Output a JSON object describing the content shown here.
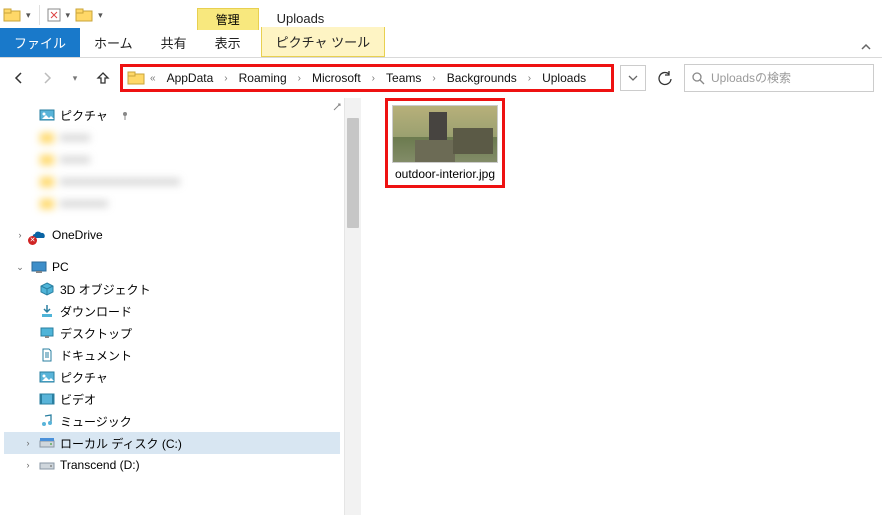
{
  "window": {
    "title": "Uploads"
  },
  "ribbon": {
    "context_tab": "管理",
    "file": "ファイル",
    "home": "ホーム",
    "share": "共有",
    "view": "表示",
    "picture_tools": "ピクチャ ツール"
  },
  "address": {
    "overflow": "«",
    "crumbs": [
      "AppData",
      "Roaming",
      "Microsoft",
      "Teams",
      "Backgrounds",
      "Uploads"
    ]
  },
  "search": {
    "placeholder": "Uploadsの検索"
  },
  "tree": {
    "quick_access_label": "ピクチャ",
    "blurred_items": [
      "xxxxx",
      "xxxxx",
      "xxxxxxxxxxxxxxxxxxxx",
      "xxxxxxxx"
    ],
    "onedrive": "OneDrive",
    "pc": "PC",
    "pc_children": [
      {
        "label": "3D オブジェクト",
        "icon": "cube"
      },
      {
        "label": "ダウンロード",
        "icon": "download"
      },
      {
        "label": "デスクトップ",
        "icon": "desktop"
      },
      {
        "label": "ドキュメント",
        "icon": "document"
      },
      {
        "label": "ピクチャ",
        "icon": "picture"
      },
      {
        "label": "ビデオ",
        "icon": "video"
      },
      {
        "label": "ミュージック",
        "icon": "music"
      }
    ],
    "local_disk": "ローカル ディスク (C:)",
    "transcend": "Transcend (D:)"
  },
  "files": [
    {
      "name": "outdoor-interior.jpg"
    }
  ]
}
